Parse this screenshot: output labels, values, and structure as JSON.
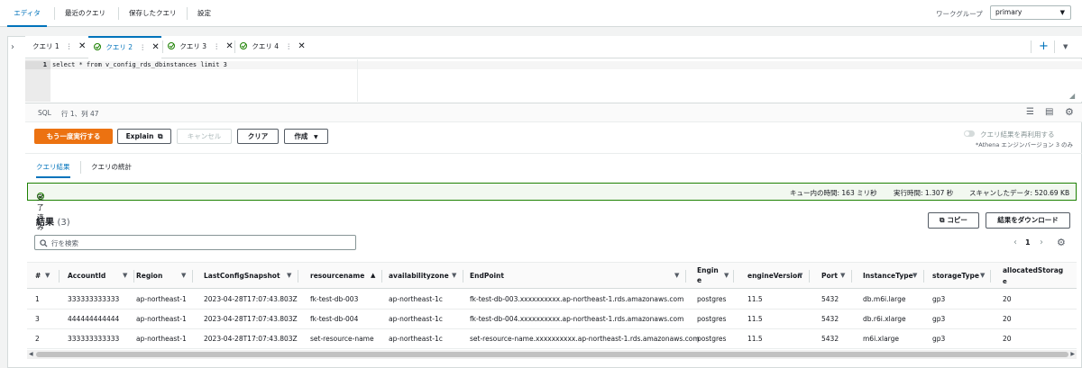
{
  "top_tabs": [
    "エディタ",
    "最近のクエリ",
    "保存したクエリ",
    "設定"
  ],
  "workgroup": {
    "label": "ワークグループ",
    "value": "primary"
  },
  "query_tabs": [
    "クエリ 1",
    "クエリ 2",
    "クエリ 3",
    "クエリ 4"
  ],
  "editor": {
    "line_number": "1",
    "code": "select * from v_config_rds_dbinstances limit 3"
  },
  "status": {
    "language": "SQL",
    "position": "行 1、列 47"
  },
  "actions": {
    "run_again": "もう一度実行する",
    "explain": "Explain",
    "cancel": "キャンセル",
    "clear": "クリア",
    "create": "作成",
    "reuse_label": "クエリ結果を再利用する",
    "reuse_note": "*Athena エンジンバージョン 3 のみ"
  },
  "result_tabs": [
    "クエリ結果",
    "クエリの統計"
  ],
  "completion": {
    "status": "完了済み",
    "queue_time": "キュー内の時間:  163 ミリ秒",
    "run_time": "実行時間:  1.307 秒",
    "data_scanned": "スキャンしたデータ:  520.69 KB"
  },
  "results": {
    "title": "結果",
    "count": "(3)",
    "copy_label": "コピー",
    "download_label": "結果をダウンロード",
    "search_placeholder": "行を検索",
    "page": "1"
  },
  "table": {
    "columns": [
      "#",
      "AccountId",
      "Region",
      "LastConfigSnapshot",
      "resourcename",
      "availabilityzone",
      "EndPoint",
      "Engine",
      "engineVersion",
      "Port",
      "InstanceType",
      "storageType",
      "allocatedStorage"
    ],
    "rows": [
      [
        "1",
        "333333333333",
        "ap-northeast-1",
        "2023-04-28T17:07:43.803Z",
        "fk-test-db-003",
        "ap-northeast-1c",
        "fk-test-db-003.xxxxxxxxxx.ap-northeast-1.rds.amazonaws.com",
        "postgres",
        "11.5",
        "5432",
        "db.m6i.large",
        "gp3",
        "20"
      ],
      [
        "3",
        "444444444444",
        "ap-northeast-1",
        "2023-04-28T17:07:43.803Z",
        "fk-test-db-004",
        "ap-northeast-1c",
        "fk-test-db-004.xxxxxxxxxx.ap-northeast-1.rds.amazonaws.com",
        "postgres",
        "11.5",
        "5432",
        "db.r6i.xlarge",
        "gp3",
        "20"
      ],
      [
        "2",
        "333333333333",
        "ap-northeast-1",
        "2023-04-28T17:07:43.803Z",
        "set-resource-name",
        "ap-northeast-1c",
        "set-resource-name.xxxxxxxxxx.ap-northeast-1.rds.amazonaws.com",
        "postgres",
        "11.5",
        "5432",
        "m6i.xlarge",
        "gp3",
        "20"
      ]
    ]
  },
  "colors": {
    "accent": "#0073bb",
    "primary_button": "#ec7211",
    "success": "#1d8102"
  }
}
